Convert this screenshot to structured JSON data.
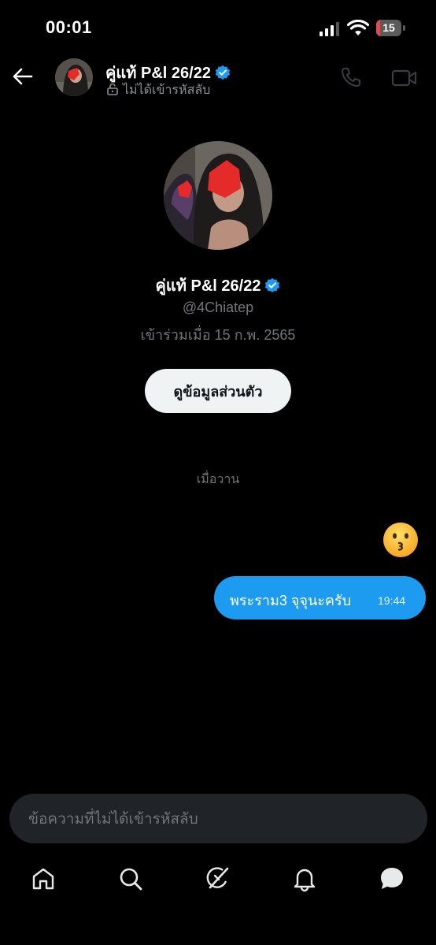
{
  "status_bar": {
    "time": "00:01",
    "battery": "15",
    "battery_level": 0.15
  },
  "header": {
    "name": "คู่แท้ P&l 26/22",
    "subtitle": "ไม่ได้เข้ารหัสลับ",
    "icons": [
      "back-arrow-icon",
      "verified-icon",
      "lock-icon",
      "phone-icon",
      "video-icon"
    ]
  },
  "profile": {
    "name": "คู่แท้ P&l 26/22",
    "handle": "@4Chiatep",
    "joined": "เข้าร่วมเมื่อ 15 ก.พ. 2565",
    "button_label": "ดูข้อมูลส่วนตัว"
  },
  "conversation": {
    "date_separator": "เมื่อวาน",
    "messages": [
      {
        "type": "emoji",
        "content": "kissing-face-emoji"
      },
      {
        "type": "text",
        "text": "พระราม3 จุจุนะครับ",
        "time": "19:44"
      }
    ]
  },
  "composer": {
    "placeholder": "ข้อความที่ไม่ได้เข้ารหัสลับ"
  },
  "tab_bar": {
    "icons": [
      "home-icon",
      "search-icon",
      "grok-icon",
      "notifications-icon",
      "messages-icon"
    ]
  },
  "colors": {
    "accent": "#1d9bf0",
    "background": "#000000",
    "muted": "#71767b"
  }
}
